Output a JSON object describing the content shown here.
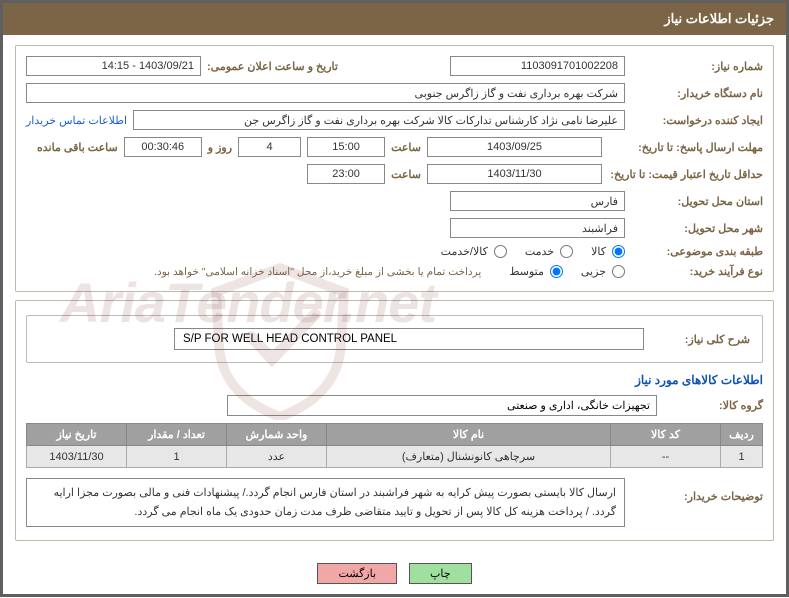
{
  "header": {
    "title": "جزئیات اطلاعات نیاز"
  },
  "top": {
    "need_no_label": "شماره نیاز:",
    "need_no": "1103091701002208",
    "ann_date_label": "تاریخ و ساعت اعلان عمومی:",
    "ann_date": "1403/09/21 - 14:15",
    "buyer_org_label": "نام دستگاه خریدار:",
    "buyer_org": "شرکت بهره برداری نفت و گاز زاگرس جنوبی",
    "requester_label": "ایجاد کننده درخواست:",
    "requester": "علیرضا نامی نژاد کارشناس تدارکات کالا شرکت بهره برداری نفت و گاز زاگرس جن",
    "contact_link": "اطلاعات تماس خریدار",
    "deadline_label": "مهلت ارسال پاسخ: تا تاریخ:",
    "deadline_date": "1403/09/25",
    "hour_label": "ساعت",
    "deadline_hour": "15:00",
    "days_value": "4",
    "days_and": "روز و",
    "countdown": "00:30:46",
    "remaining": "ساعت باقی مانده",
    "validity_label": "حداقل تاریخ اعتبار قیمت: تا تاریخ:",
    "validity_date": "1403/11/30",
    "validity_hour": "23:00",
    "province_label": "استان محل تحویل:",
    "province": "فارس",
    "city_label": "شهر محل تحویل:",
    "city": "فراشبند",
    "category_label": "طبقه بندی موضوعی:",
    "opt_goods": "کالا",
    "opt_service": "خدمت",
    "opt_both": "کالا/خدمت",
    "process_label": "نوع فرآیند خرید:",
    "opt_small": "جزیی",
    "opt_medium": "متوسط",
    "process_note": "پرداخت تمام یا بخشی از مبلغ خرید،از محل \"اسناد خزانه اسلامی\" خواهد بود."
  },
  "detail": {
    "desc_label": "شرح کلی نیاز:",
    "desc_value": "S/P FOR WELL HEAD CONTROL PANEL",
    "info_title": "اطلاعات کالاهای مورد نیاز",
    "group_label": "گروه کالا:",
    "group_value": "تجهیزات خانگی، اداری و صنعتی"
  },
  "table": {
    "h_row": "ردیف",
    "h_code": "کد کالا",
    "h_name": "نام کالا",
    "h_unit": "واحد شمارش",
    "h_qty": "تعداد / مقدار",
    "h_date": "تاریخ نیاز",
    "rows": [
      {
        "idx": "1",
        "code": "--",
        "name": "سرچاهی کانونشنال (متعارف)",
        "unit": "عدد",
        "qty": "1",
        "date": "1403/11/30"
      }
    ]
  },
  "notes": {
    "label": "توضیحات خریدار:",
    "text": "ارسال کالا بایستی بصورت پیش کرایه به شهر فراشبند در استان فارس انجام گردد./ پیشنهادات فنی و مالی بصورت مجزا ارایه گردد. / پرداخت هزینه کل کالا پس از تحویل و تایید متقاضی ظرف مدت زمان حدودی یک ماه انجام می گردد."
  },
  "buttons": {
    "print": "چاپ",
    "back": "بازگشت"
  },
  "watermark": "AriaTender.net"
}
